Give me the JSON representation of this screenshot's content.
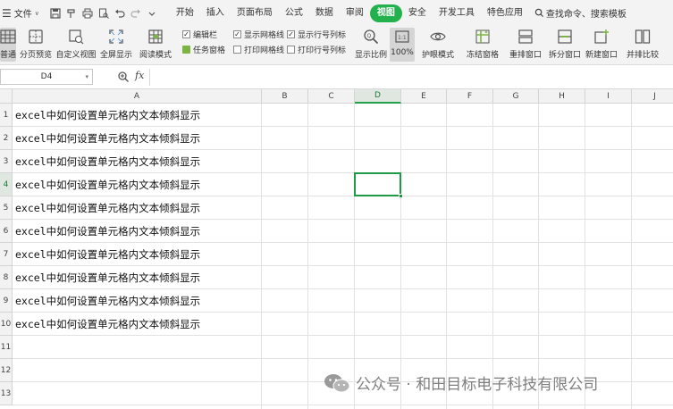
{
  "menubar": {
    "file_label": "文件",
    "quick_access": [
      "save-icon",
      "format-painter-icon",
      "print-icon",
      "print-preview-icon",
      "undo-icon",
      "redo-icon",
      "more-icon"
    ],
    "tabs": [
      "开始",
      "插入",
      "页面布局",
      "公式",
      "数据",
      "审阅",
      "视图",
      "安全",
      "开发工具",
      "特色应用"
    ],
    "active_tab": "视图",
    "search_label": "查找命令、搜索模板",
    "accent_color": "#22b14c"
  },
  "ribbon": {
    "normal_label": "普通",
    "page_break_label": "分页预览",
    "custom_view_label": "自定义视图",
    "fullscreen_label": "全屏显示",
    "reading_mode_label": "阅读模式",
    "edit_bar_label": "编辑栏",
    "task_pane_label": "任务窗格",
    "show_gridlines_label": "显示网格线",
    "print_gridlines_label": "打印网格线",
    "show_rowcol_label": "显示行号列标",
    "print_rowcol_label": "打印行号列标",
    "zoom_ratio_label": "显示比例",
    "zoom_100_label": "100%",
    "eye_mode_label": "护眼模式",
    "freeze_label": "冻结窗格",
    "rearrange_label": "重排窗口",
    "split_label": "拆分窗口",
    "new_window_label": "新建窗口",
    "side_by_side_label": "并排比较",
    "checks": {
      "edit_bar": true,
      "show_gridlines": true,
      "show_rowcol": true,
      "print_gridlines": false,
      "print_rowcol": false
    }
  },
  "formula_bar": {
    "name_box": "D4",
    "fx_label": "fx",
    "formula": ""
  },
  "sheet": {
    "columns": [
      "A",
      "B",
      "C",
      "D",
      "E",
      "F",
      "G",
      "H",
      "I",
      "J"
    ],
    "rows": [
      "1",
      "2",
      "3",
      "4",
      "5",
      "6",
      "7",
      "8",
      "9",
      "10",
      "11",
      "12",
      "13"
    ],
    "selected_column": "D",
    "selected_row": "4",
    "cells_a": [
      "excel中如何设置单元格内文本倾斜显示",
      "excel中如何设置单元格内文本倾斜显示",
      "excel中如何设置单元格内文本倾斜显示",
      "excel中如何设置单元格内文本倾斜显示",
      "excel中如何设置单元格内文本倾斜显示",
      "excel中如何设置单元格内文本倾斜显示",
      "excel中如何设置单元格内文本倾斜显示",
      "excel中如何设置单元格内文本倾斜显示",
      "excel中如何设置单元格内文本倾斜显示",
      "excel中如何设置单元格内文本倾斜显示"
    ]
  },
  "watermark": {
    "text": "公众号 · 和田目标电子科技有限公司"
  }
}
